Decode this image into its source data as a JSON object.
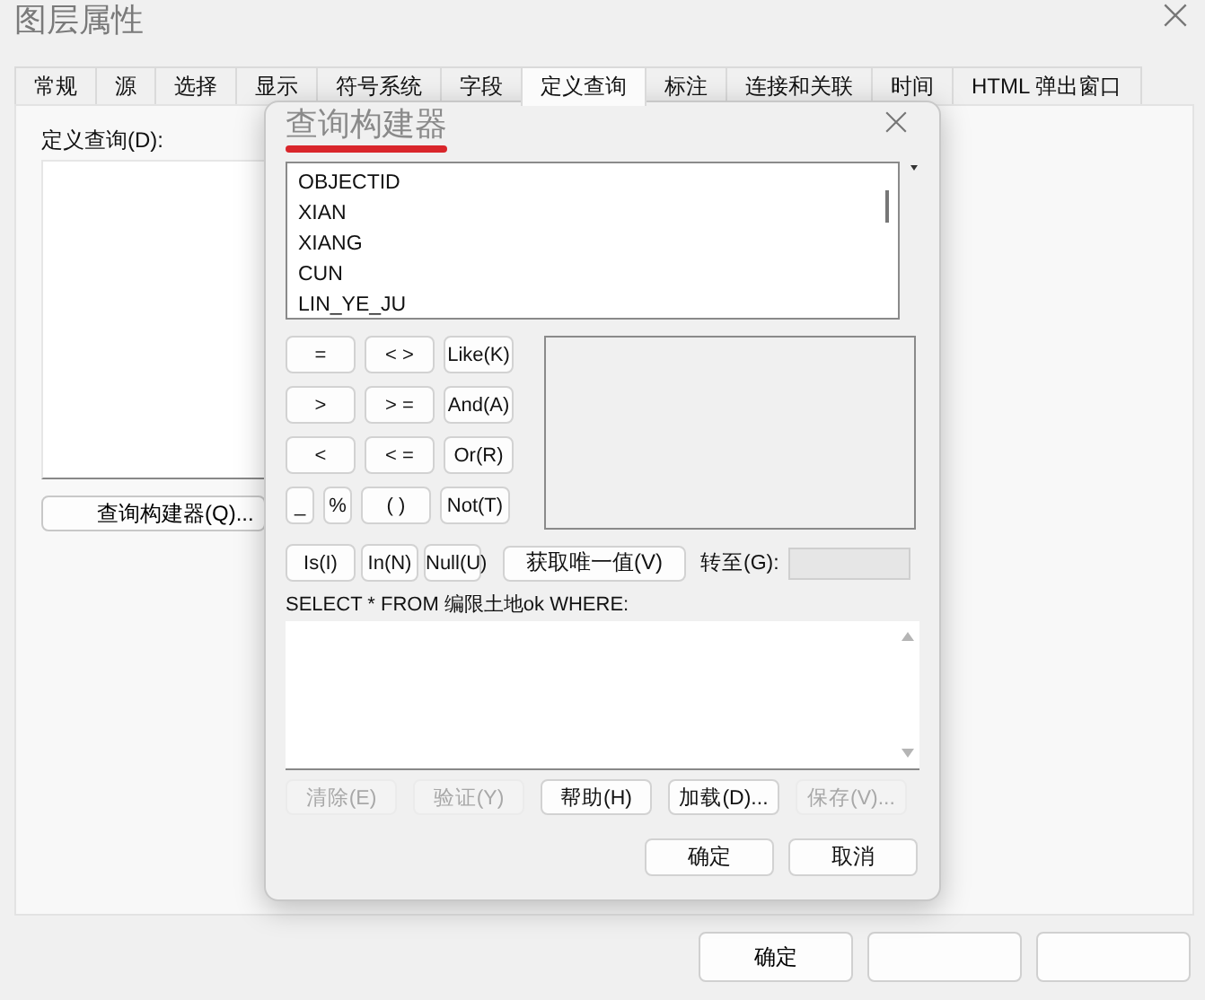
{
  "window": {
    "title": "图层属性"
  },
  "tabs": [
    {
      "label": "常规",
      "selected": false
    },
    {
      "label": "源",
      "selected": false
    },
    {
      "label": "选择",
      "selected": false
    },
    {
      "label": "显示",
      "selected": false
    },
    {
      "label": "符号系统",
      "selected": false
    },
    {
      "label": "字段",
      "selected": false
    },
    {
      "label": "定义查询",
      "selected": true
    },
    {
      "label": "标注",
      "selected": false
    },
    {
      "label": "连接和关联",
      "selected": false
    },
    {
      "label": "时间",
      "selected": false
    },
    {
      "label": "HTML 弹出窗口",
      "selected": false
    }
  ],
  "definition_query": {
    "label": "定义查询(D):",
    "query_builder_button": "查询构建器(Q)..."
  },
  "query_builder": {
    "title": "查询构建器",
    "fields": [
      "OBJECTID",
      "XIAN",
      "XIANG",
      "CUN",
      "LIN_YE_JU"
    ],
    "operator_rows": [
      [
        {
          "label": "=",
          "kind": "normal"
        },
        {
          "label": "< >",
          "kind": "normal"
        },
        {
          "label": "Like(K)",
          "kind": "normal"
        }
      ],
      [
        {
          "label": ">",
          "kind": "normal"
        },
        {
          "label": "> =",
          "kind": "normal"
        },
        {
          "label": "And(A)",
          "kind": "normal"
        }
      ],
      [
        {
          "label": "<",
          "kind": "normal"
        },
        {
          "label": "< =",
          "kind": "normal"
        },
        {
          "label": "Or(R)",
          "kind": "normal"
        }
      ],
      [
        {
          "label": "_",
          "kind": "narrow"
        },
        {
          "label": "%",
          "kind": "narrow"
        },
        {
          "label": "( )",
          "kind": "normal"
        },
        {
          "label": "Not(T)",
          "kind": "normal"
        }
      ]
    ],
    "small_operators": [
      {
        "label": "Is(I)",
        "kind": "normal"
      },
      {
        "label": "In(N)",
        "kind": "compact"
      },
      {
        "label": "Null(U)",
        "kind": "compact"
      }
    ],
    "unique_values_button": "获取唯一值(V)",
    "go_to_label": "转至(G):",
    "sql_prefix": "SELECT * FROM 编限土地ok WHERE:",
    "actions": [
      {
        "label": "清除(E)",
        "disabled": true
      },
      {
        "label": "验证(Y)",
        "disabled": true
      },
      {
        "label": "帮助(H)",
        "disabled": false
      },
      {
        "label": "加载(D)...",
        "disabled": false
      },
      {
        "label": "保存(V)...",
        "disabled": true
      }
    ],
    "buttons": [
      "确定",
      "取消"
    ]
  },
  "footer_buttons": [
    "确定"
  ]
}
